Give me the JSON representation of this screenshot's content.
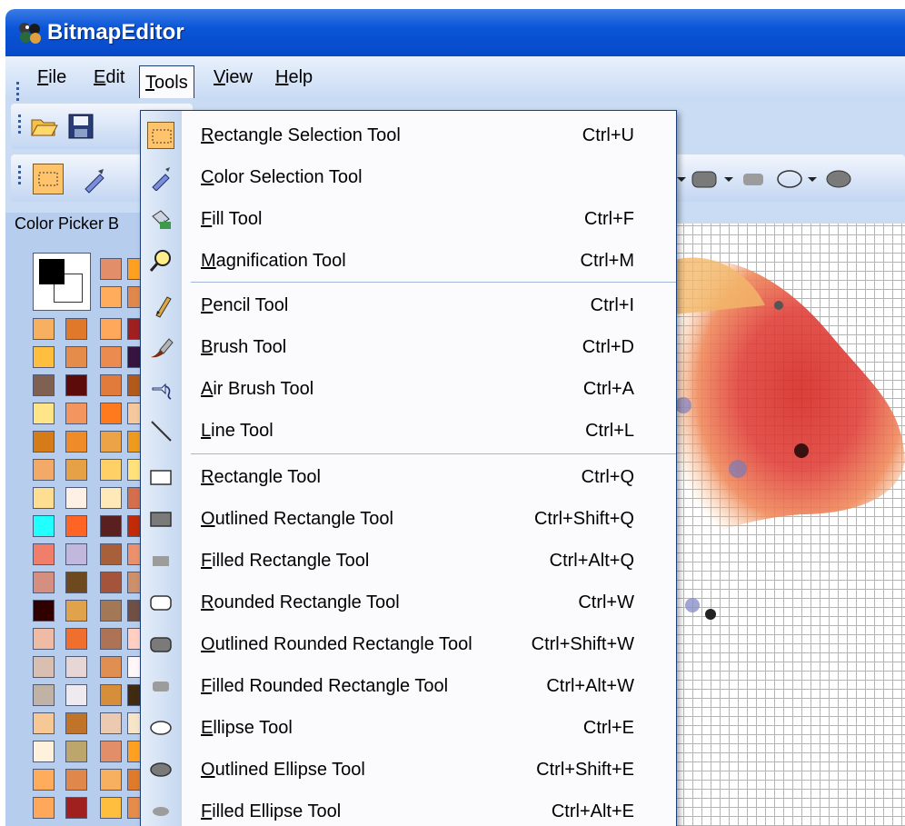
{
  "app": {
    "title": "BitmapEditor"
  },
  "menubar": {
    "items": [
      "File",
      "Edit",
      "Tools",
      "View",
      "Help"
    ]
  },
  "panel": {
    "header": "Color Picker B"
  },
  "colors": {
    "palette": [
      "#e28e68",
      "#ffa020",
      "#ffad5c",
      "#e0884c",
      "#f7b060",
      "#e07a2a",
      "#ffa75a",
      "#a02020",
      "#ffbe3d",
      "#e58c4b",
      "#ec8b4f",
      "#37143f",
      "#806050",
      "#5c0a0a",
      "#e07b3c",
      "#b25a19",
      "#ffe488",
      "#f3955f",
      "#ff7a1c",
      "#f6c89d",
      "#d57b18",
      "#f08b2a",
      "#eca246",
      "#ee9b1d",
      "#f3aa68",
      "#e6a146",
      "#ffd066",
      "#ffe27a",
      "#ffdd91",
      "#fff0e6",
      "#ffe9b9",
      "#d56e4b",
      "#22ffff",
      "#ff6424",
      "#5a2020",
      "#c02a07",
      "#f07e6a",
      "#c2b8dd",
      "#a8603b",
      "#ea916c",
      "#d48f80",
      "#6e4920",
      "#a3543a",
      "#ce8f6b",
      "#300000",
      "#e0a24b",
      "#a27856",
      "#704f45",
      "#efbba5",
      "#f06f2d",
      "#ae7354",
      "#ffcfc3",
      "#d8bfb0",
      "#e6d7d6",
      "#e18e52",
      "#fff7f7",
      "#c0b2a4",
      "#eeeaf0",
      "#d78e3a",
      "#402b11",
      "#f6c895",
      "#c0742a",
      "#ecc9b1",
      "#f6e5c6",
      "#fff2dc",
      "#bda66c"
    ],
    "accent": "#ffc36c"
  },
  "menu": {
    "items": [
      {
        "label": "Rectangle Selection Tool",
        "mnemonic": "R",
        "shortcut": "Ctrl+U",
        "icon": "rect-select-icon",
        "checked": true
      },
      {
        "label": "Color Selection Tool",
        "mnemonic": "C",
        "shortcut": "",
        "icon": "eyedropper-icon"
      },
      {
        "label": "Fill Tool",
        "mnemonic": "F",
        "shortcut": "Ctrl+F",
        "icon": "paint-bucket-icon"
      },
      {
        "label": "Magnification Tool",
        "mnemonic": "M",
        "shortcut": "Ctrl+M",
        "icon": "magnifier-icon"
      },
      {
        "label": "Pencil Tool",
        "mnemonic": "P",
        "shortcut": "Ctrl+I",
        "icon": "pencil-icon"
      },
      {
        "label": "Brush Tool",
        "mnemonic": "B",
        "shortcut": "Ctrl+D",
        "icon": "brush-icon"
      },
      {
        "label": "Air Brush Tool",
        "mnemonic": "A",
        "shortcut": "Ctrl+A",
        "icon": "airbrush-icon"
      },
      {
        "label": "Line Tool",
        "mnemonic": "L",
        "shortcut": "Ctrl+L",
        "icon": "line-icon"
      },
      {
        "label": "Rectangle Tool",
        "mnemonic": "R",
        "shortcut": "Ctrl+Q",
        "icon": "rectangle-icon"
      },
      {
        "label": "Outlined Rectangle Tool",
        "mnemonic": "O",
        "shortcut": "Ctrl+Shift+Q",
        "icon": "outlined-rectangle-icon"
      },
      {
        "label": "Filled Rectangle Tool",
        "mnemonic": "F",
        "shortcut": "Ctrl+Alt+Q",
        "icon": "filled-rectangle-icon"
      },
      {
        "label": "Rounded Rectangle Tool",
        "mnemonic": "R",
        "shortcut": "Ctrl+W",
        "icon": "rounded-rectangle-icon"
      },
      {
        "label": "Outlined Rounded Rectangle Tool",
        "mnemonic": "O",
        "shortcut": "Ctrl+Shift+W",
        "icon": "outlined-rounded-rectangle-icon"
      },
      {
        "label": "Filled Rounded Rectangle Tool",
        "mnemonic": "F",
        "shortcut": "Ctrl+Alt+W",
        "icon": "filled-rounded-rectangle-icon"
      },
      {
        "label": "Ellipse Tool",
        "mnemonic": "E",
        "shortcut": "Ctrl+E",
        "icon": "ellipse-icon"
      },
      {
        "label": "Outlined Ellipse Tool",
        "mnemonic": "O",
        "shortcut": "Ctrl+Shift+E",
        "icon": "outlined-ellipse-icon"
      },
      {
        "label": "Filled Ellipse Tool",
        "mnemonic": "F",
        "shortcut": "Ctrl+Alt+E",
        "icon": "filled-ellipse-icon"
      }
    ]
  }
}
